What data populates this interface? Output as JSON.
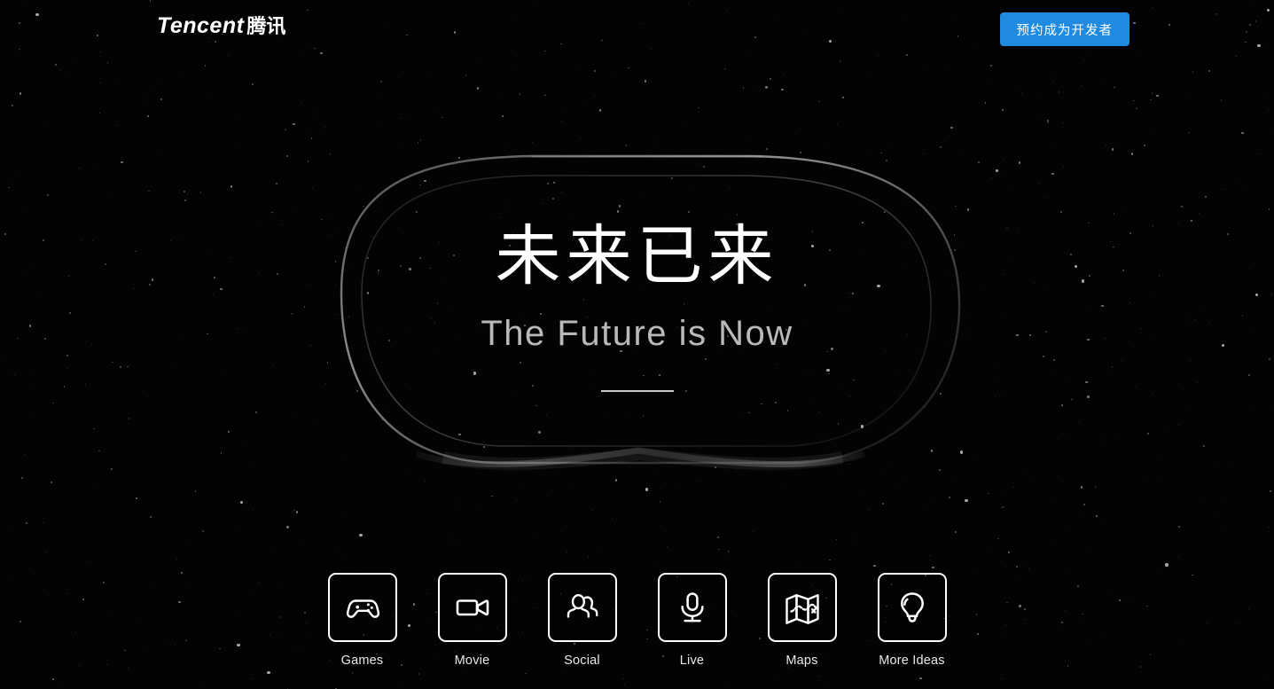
{
  "header": {
    "logo_text": "Tencent",
    "logo_cn": "腾讯",
    "cta_label": "预约成为开发者",
    "cta_color": "#1f8ae0"
  },
  "hero": {
    "headline_cn": "未来已来",
    "headline_en": "The Future is Now"
  },
  "icons": [
    {
      "label": "Games",
      "icon": "gamepad-icon"
    },
    {
      "label": "Movie",
      "icon": "video-camera-icon"
    },
    {
      "label": "Social",
      "icon": "people-icon"
    },
    {
      "label": "Live",
      "icon": "microphone-icon"
    },
    {
      "label": "Maps",
      "icon": "folded-map-icon"
    },
    {
      "label": "More Ideas",
      "icon": "lightbulb-icon"
    }
  ],
  "background": {
    "style": "starfield",
    "artwork": "vr-headset-outline",
    "base_color": "#030303",
    "star_color": "#cfcfcf"
  }
}
